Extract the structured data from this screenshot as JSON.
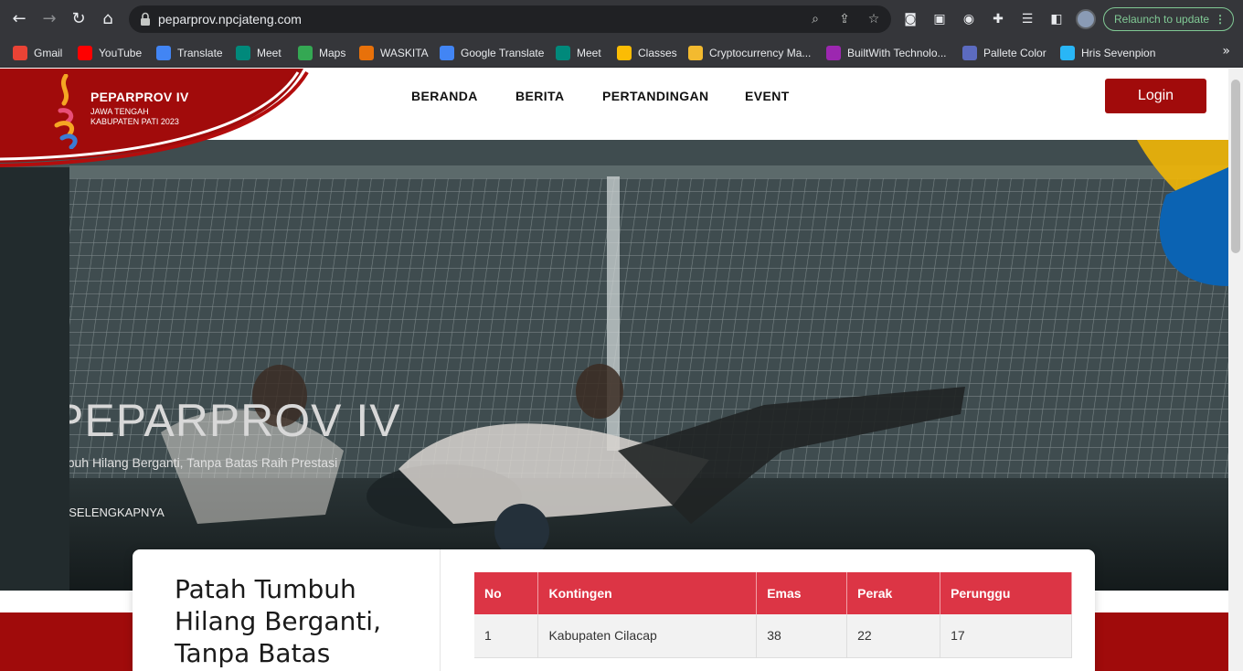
{
  "browser": {
    "url": "peparprov.npcjateng.com",
    "relaunch_label": "Relaunch to update",
    "bookmarks": [
      {
        "label": "Gmail",
        "color": "#ea4335"
      },
      {
        "label": "YouTube",
        "color": "#ff0000"
      },
      {
        "label": "Translate",
        "color": "#4285f4"
      },
      {
        "label": "Meet",
        "color": "#00897b"
      },
      {
        "label": "Maps",
        "color": "#34a853"
      },
      {
        "label": "WASKITA",
        "color": "#e8710a"
      },
      {
        "label": "Google Translate",
        "color": "#4285f4"
      },
      {
        "label": "Meet",
        "color": "#00897b"
      },
      {
        "label": "Classes",
        "color": "#fbbc04"
      },
      {
        "label": "Cryptocurrency Ma...",
        "color": "#f3ba2f"
      },
      {
        "label": "BuiltWith Technolo...",
        "color": "#9c27b0"
      },
      {
        "label": "Pallete Color",
        "color": "#5c6bc0"
      },
      {
        "label": "Hris Sevenpion",
        "color": "#29b6f6"
      }
    ]
  },
  "site": {
    "logo": {
      "title": "PEPARPROV IV",
      "line2": "JAWA TENGAH",
      "line3": "KABUPATEN PATI 2023"
    },
    "menu": [
      "BERANDA",
      "BERITA",
      "PERTANDINGAN",
      "EVENT"
    ],
    "login_label": "Login",
    "colors": {
      "brand_red": "#a10b0b",
      "table_header": "#dc3545"
    }
  },
  "hero": {
    "title": "PEPARPROV IV",
    "subtitle": "Patah Tumbuh Hilang Berganti, Tanpa Batas Raih Prestasi",
    "cta": "LIHAT SELENGKAPNYA"
  },
  "card": {
    "title": "Patah Tumbuh Hilang Berganti, Tanpa Batas",
    "table": {
      "headers": [
        "No",
        "Kontingen",
        "Emas",
        "Perak",
        "Perunggu"
      ],
      "rows": [
        [
          "1",
          "Kabupaten Cilacap",
          "38",
          "22",
          "17"
        ]
      ]
    }
  }
}
